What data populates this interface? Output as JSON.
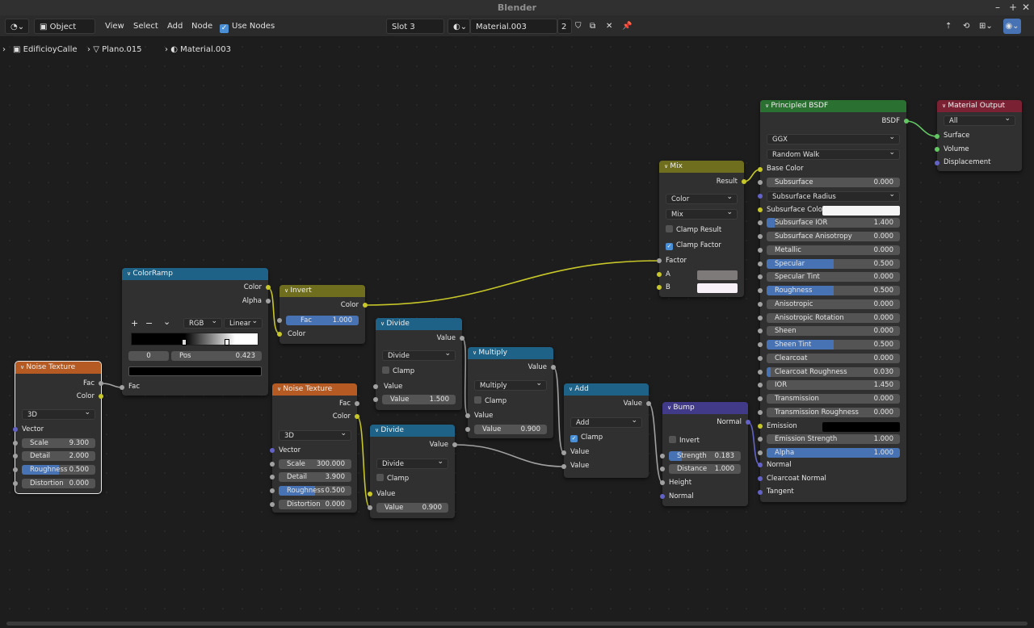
{
  "window": {
    "title": "Blender"
  },
  "header": {
    "mode": "Object",
    "menus": [
      "View",
      "Select",
      "Add",
      "Node"
    ],
    "use_nodes": "Use Nodes",
    "slot": "Slot 3",
    "material": "Material.003",
    "users": "2"
  },
  "breadcrumb": {
    "object": "EdificioyCalle",
    "mesh": "Plano.015",
    "material": "Material.003"
  },
  "nodes": {
    "noise1": {
      "title": "Noise Texture",
      "out_fac": "Fac",
      "out_color": "Color",
      "dim": "3D",
      "in_vector": "Vector",
      "scale_l": "Scale",
      "scale": "9.300",
      "detail_l": "Detail",
      "detail": "2.000",
      "rough_l": "Roughness",
      "rough": "0.500",
      "dist_l": "Distortion",
      "dist": "0.000"
    },
    "ramp": {
      "title": "ColorRamp",
      "out_color": "Color",
      "out_alpha": "Alpha",
      "plus": "+",
      "minus": "−",
      "menu": "⌄",
      "mode": "RGB",
      "interp": "Linear",
      "idx": "0",
      "pos_l": "Pos",
      "pos": "0.423",
      "in_fac": "Fac"
    },
    "invert": {
      "title": "Invert",
      "out_color": "Color",
      "fac_l": "Fac",
      "fac": "1.000",
      "in_color": "Color"
    },
    "divide1": {
      "title": "Divide",
      "out": "Value",
      "op": "Divide",
      "clamp": "Clamp",
      "in_value": "Value",
      "val_l": "Value",
      "val": "1.500"
    },
    "multiply": {
      "title": "Multiply",
      "out": "Value",
      "op": "Multiply",
      "clamp": "Clamp",
      "in_value": "Value",
      "val_l": "Value",
      "val": "0.900"
    },
    "noise2": {
      "title": "Noise Texture",
      "out_fac": "Fac",
      "out_color": "Color",
      "dim": "3D",
      "in_vector": "Vector",
      "scale_l": "Scale",
      "scale": "300.000",
      "detail_l": "Detail",
      "detail": "3.900",
      "rough_l": "Roughness",
      "rough": "0.500",
      "dist_l": "Distortion",
      "dist": "0.000"
    },
    "divide2": {
      "title": "Divide",
      "out": "Value",
      "op": "Divide",
      "clamp": "Clamp",
      "in_value": "Value",
      "val_l": "Value",
      "val": "0.900"
    },
    "add": {
      "title": "Add",
      "out": "Value",
      "op": "Add",
      "clamp": "Clamp",
      "in1": "Value",
      "in2": "Value"
    },
    "bump": {
      "title": "Bump",
      "out": "Normal",
      "invert": "Invert",
      "str_l": "Strength",
      "str": "0.183",
      "dist_l": "Distance",
      "dist": "1.000",
      "in_height": "Height",
      "in_normal": "Normal"
    },
    "mix": {
      "title": "Mix",
      "out": "Result",
      "type": "Color",
      "blend": "Mix",
      "clamp_result": "Clamp Result",
      "clamp_factor": "Clamp Factor",
      "in_factor": "Factor",
      "in_a": "A",
      "in_b": "B"
    },
    "bsdf": {
      "title": "Principled BSDF",
      "out": "BSDF",
      "dist": "GGX",
      "sss": "Random Walk",
      "base": "Base Color",
      "params": [
        {
          "label": "Subsurface",
          "value": "0.000",
          "fill": 0
        },
        {
          "label": "Subsurface Radius",
          "value": "",
          "fill": 0
        },
        {
          "label": "Subsurface Color",
          "value": "",
          "fill": 0
        },
        {
          "label": "Subsurface IOR",
          "value": "1.400",
          "fill": 0.06
        },
        {
          "label": "Subsurface Anisotropy",
          "value": "0.000",
          "fill": 0
        },
        {
          "label": "Metallic",
          "value": "0.000",
          "fill": 0
        },
        {
          "label": "Specular",
          "value": "0.500",
          "fill": 0.5
        },
        {
          "label": "Specular Tint",
          "value": "0.000",
          "fill": 0
        },
        {
          "label": "Roughness",
          "value": "0.500",
          "fill": 0.5
        },
        {
          "label": "Anisotropic",
          "value": "0.000",
          "fill": 0
        },
        {
          "label": "Anisotropic Rotation",
          "value": "0.000",
          "fill": 0
        },
        {
          "label": "Sheen",
          "value": "0.000",
          "fill": 0
        },
        {
          "label": "Sheen Tint",
          "value": "0.500",
          "fill": 0.5
        },
        {
          "label": "Clearcoat",
          "value": "0.000",
          "fill": 0
        },
        {
          "label": "Clearcoat Roughness",
          "value": "0.030",
          "fill": 0.03
        },
        {
          "label": "IOR",
          "value": "1.450",
          "fill": 0
        },
        {
          "label": "Transmission",
          "value": "0.000",
          "fill": 0
        },
        {
          "label": "Transmission Roughness",
          "value": "0.000",
          "fill": 0
        },
        {
          "label": "Emission",
          "value": "",
          "fill": 0
        },
        {
          "label": "Emission Strength",
          "value": "1.000",
          "fill": 0
        },
        {
          "label": "Alpha",
          "value": "1.000",
          "fill": 1
        }
      ],
      "normal": "Normal",
      "clearcoat_normal": "Clearcoat Normal",
      "tangent": "Tangent"
    },
    "output": {
      "title": "Material Output",
      "target": "All",
      "surface": "Surface",
      "volume": "Volume",
      "displacement": "Displacement"
    }
  },
  "colors": {
    "accent": "#4772b3",
    "mix_a": "#7f7a7a",
    "mix_b": "#f7f0f7",
    "subsurface_color": "#f5f5f5",
    "emission_color": "#000000"
  }
}
